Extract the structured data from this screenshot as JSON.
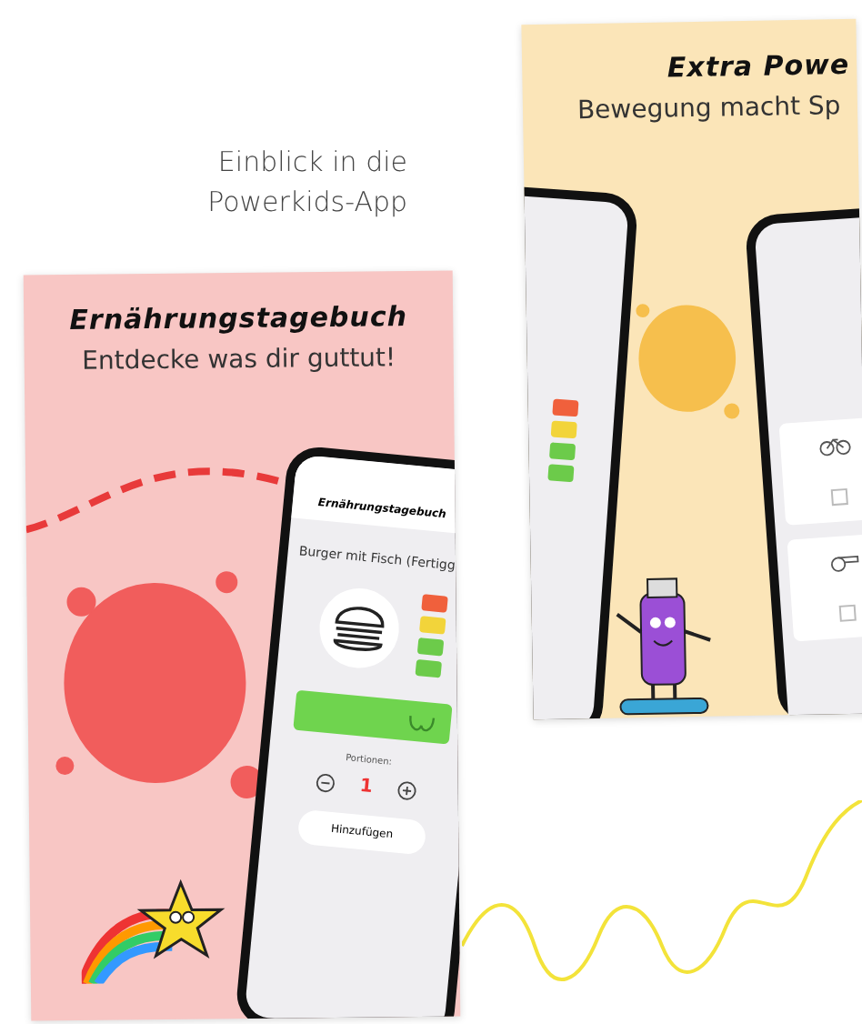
{
  "heading": "Einblick in die Powerkids-App",
  "cards": [
    {
      "kind": "food",
      "title": "Ernährungstagebuch",
      "subtitle": "Entdecke was dir guttut!",
      "phone": {
        "title": "Ernährungstagebuch",
        "food_name": "Burger mit Fisch (Fertigg",
        "ratings": [
          {
            "color": "#f0603c"
          },
          {
            "color": "#f2d43a"
          },
          {
            "color": "#6ccb4a"
          },
          {
            "color": "#6ccb4a"
          }
        ],
        "portions_label": "Portionen:",
        "portion_count": "1",
        "add_button": "Hinzufügen"
      }
    },
    {
      "kind": "move",
      "title": "Extra Powe",
      "subtitle": "Bewegung macht Sp",
      "phone": {
        "ratings": [
          {
            "color": "#f0603c"
          },
          {
            "color": "#f2d43a"
          },
          {
            "color": "#6ccb4a"
          },
          {
            "color": "#6ccb4a"
          }
        ],
        "activities": [
          {
            "checked": false
          },
          {
            "checked": false
          }
        ]
      }
    }
  ]
}
